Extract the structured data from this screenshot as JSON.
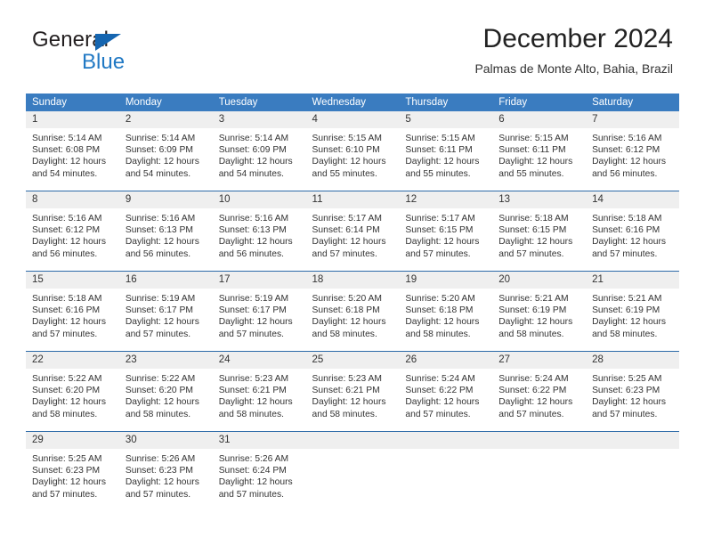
{
  "brand": {
    "name_part1": "General",
    "name_part2": "Blue",
    "triangle_color": "#1565b0",
    "blue_color": "#2179c4"
  },
  "header": {
    "title": "December 2024",
    "location": "Palmas de Monte Alto, Bahia, Brazil"
  },
  "theme": {
    "header_row_background": "#3a7cc0",
    "header_row_text": "#ffffff",
    "daynum_background": "#efefef",
    "row_divider": "#2c6aa8",
    "body_text": "#333333"
  },
  "weekday_headers": [
    "Sunday",
    "Monday",
    "Tuesday",
    "Wednesday",
    "Thursday",
    "Friday",
    "Saturday"
  ],
  "labels": {
    "sunrise_prefix": "Sunrise:",
    "sunset_prefix": "Sunset:",
    "daylight_prefix": "Daylight:"
  },
  "weeks": [
    [
      {
        "day": "1",
        "sunrise": "Sunrise: 5:14 AM",
        "sunset": "Sunset: 6:08 PM",
        "daylight_line1": "Daylight: 12 hours",
        "daylight_line2": "and 54 minutes."
      },
      {
        "day": "2",
        "sunrise": "Sunrise: 5:14 AM",
        "sunset": "Sunset: 6:09 PM",
        "daylight_line1": "Daylight: 12 hours",
        "daylight_line2": "and 54 minutes."
      },
      {
        "day": "3",
        "sunrise": "Sunrise: 5:14 AM",
        "sunset": "Sunset: 6:09 PM",
        "daylight_line1": "Daylight: 12 hours",
        "daylight_line2": "and 54 minutes."
      },
      {
        "day": "4",
        "sunrise": "Sunrise: 5:15 AM",
        "sunset": "Sunset: 6:10 PM",
        "daylight_line1": "Daylight: 12 hours",
        "daylight_line2": "and 55 minutes."
      },
      {
        "day": "5",
        "sunrise": "Sunrise: 5:15 AM",
        "sunset": "Sunset: 6:11 PM",
        "daylight_line1": "Daylight: 12 hours",
        "daylight_line2": "and 55 minutes."
      },
      {
        "day": "6",
        "sunrise": "Sunrise: 5:15 AM",
        "sunset": "Sunset: 6:11 PM",
        "daylight_line1": "Daylight: 12 hours",
        "daylight_line2": "and 55 minutes."
      },
      {
        "day": "7",
        "sunrise": "Sunrise: 5:16 AM",
        "sunset": "Sunset: 6:12 PM",
        "daylight_line1": "Daylight: 12 hours",
        "daylight_line2": "and 56 minutes."
      }
    ],
    [
      {
        "day": "8",
        "sunrise": "Sunrise: 5:16 AM",
        "sunset": "Sunset: 6:12 PM",
        "daylight_line1": "Daylight: 12 hours",
        "daylight_line2": "and 56 minutes."
      },
      {
        "day": "9",
        "sunrise": "Sunrise: 5:16 AM",
        "sunset": "Sunset: 6:13 PM",
        "daylight_line1": "Daylight: 12 hours",
        "daylight_line2": "and 56 minutes."
      },
      {
        "day": "10",
        "sunrise": "Sunrise: 5:16 AM",
        "sunset": "Sunset: 6:13 PM",
        "daylight_line1": "Daylight: 12 hours",
        "daylight_line2": "and 56 minutes."
      },
      {
        "day": "11",
        "sunrise": "Sunrise: 5:17 AM",
        "sunset": "Sunset: 6:14 PM",
        "daylight_line1": "Daylight: 12 hours",
        "daylight_line2": "and 57 minutes."
      },
      {
        "day": "12",
        "sunrise": "Sunrise: 5:17 AM",
        "sunset": "Sunset: 6:15 PM",
        "daylight_line1": "Daylight: 12 hours",
        "daylight_line2": "and 57 minutes."
      },
      {
        "day": "13",
        "sunrise": "Sunrise: 5:18 AM",
        "sunset": "Sunset: 6:15 PM",
        "daylight_line1": "Daylight: 12 hours",
        "daylight_line2": "and 57 minutes."
      },
      {
        "day": "14",
        "sunrise": "Sunrise: 5:18 AM",
        "sunset": "Sunset: 6:16 PM",
        "daylight_line1": "Daylight: 12 hours",
        "daylight_line2": "and 57 minutes."
      }
    ],
    [
      {
        "day": "15",
        "sunrise": "Sunrise: 5:18 AM",
        "sunset": "Sunset: 6:16 PM",
        "daylight_line1": "Daylight: 12 hours",
        "daylight_line2": "and 57 minutes."
      },
      {
        "day": "16",
        "sunrise": "Sunrise: 5:19 AM",
        "sunset": "Sunset: 6:17 PM",
        "daylight_line1": "Daylight: 12 hours",
        "daylight_line2": "and 57 minutes."
      },
      {
        "day": "17",
        "sunrise": "Sunrise: 5:19 AM",
        "sunset": "Sunset: 6:17 PM",
        "daylight_line1": "Daylight: 12 hours",
        "daylight_line2": "and 57 minutes."
      },
      {
        "day": "18",
        "sunrise": "Sunrise: 5:20 AM",
        "sunset": "Sunset: 6:18 PM",
        "daylight_line1": "Daylight: 12 hours",
        "daylight_line2": "and 58 minutes."
      },
      {
        "day": "19",
        "sunrise": "Sunrise: 5:20 AM",
        "sunset": "Sunset: 6:18 PM",
        "daylight_line1": "Daylight: 12 hours",
        "daylight_line2": "and 58 minutes."
      },
      {
        "day": "20",
        "sunrise": "Sunrise: 5:21 AM",
        "sunset": "Sunset: 6:19 PM",
        "daylight_line1": "Daylight: 12 hours",
        "daylight_line2": "and 58 minutes."
      },
      {
        "day": "21",
        "sunrise": "Sunrise: 5:21 AM",
        "sunset": "Sunset: 6:19 PM",
        "daylight_line1": "Daylight: 12 hours",
        "daylight_line2": "and 58 minutes."
      }
    ],
    [
      {
        "day": "22",
        "sunrise": "Sunrise: 5:22 AM",
        "sunset": "Sunset: 6:20 PM",
        "daylight_line1": "Daylight: 12 hours",
        "daylight_line2": "and 58 minutes."
      },
      {
        "day": "23",
        "sunrise": "Sunrise: 5:22 AM",
        "sunset": "Sunset: 6:20 PM",
        "daylight_line1": "Daylight: 12 hours",
        "daylight_line2": "and 58 minutes."
      },
      {
        "day": "24",
        "sunrise": "Sunrise: 5:23 AM",
        "sunset": "Sunset: 6:21 PM",
        "daylight_line1": "Daylight: 12 hours",
        "daylight_line2": "and 58 minutes."
      },
      {
        "day": "25",
        "sunrise": "Sunrise: 5:23 AM",
        "sunset": "Sunset: 6:21 PM",
        "daylight_line1": "Daylight: 12 hours",
        "daylight_line2": "and 58 minutes."
      },
      {
        "day": "26",
        "sunrise": "Sunrise: 5:24 AM",
        "sunset": "Sunset: 6:22 PM",
        "daylight_line1": "Daylight: 12 hours",
        "daylight_line2": "and 57 minutes."
      },
      {
        "day": "27",
        "sunrise": "Sunrise: 5:24 AM",
        "sunset": "Sunset: 6:22 PM",
        "daylight_line1": "Daylight: 12 hours",
        "daylight_line2": "and 57 minutes."
      },
      {
        "day": "28",
        "sunrise": "Sunrise: 5:25 AM",
        "sunset": "Sunset: 6:23 PM",
        "daylight_line1": "Daylight: 12 hours",
        "daylight_line2": "and 57 minutes."
      }
    ],
    [
      {
        "day": "29",
        "sunrise": "Sunrise: 5:25 AM",
        "sunset": "Sunset: 6:23 PM",
        "daylight_line1": "Daylight: 12 hours",
        "daylight_line2": "and 57 minutes."
      },
      {
        "day": "30",
        "sunrise": "Sunrise: 5:26 AM",
        "sunset": "Sunset: 6:23 PM",
        "daylight_line1": "Daylight: 12 hours",
        "daylight_line2": "and 57 minutes."
      },
      {
        "day": "31",
        "sunrise": "Sunrise: 5:26 AM",
        "sunset": "Sunset: 6:24 PM",
        "daylight_line1": "Daylight: 12 hours",
        "daylight_line2": "and 57 minutes."
      },
      {
        "day": "",
        "sunrise": "",
        "sunset": "",
        "daylight_line1": "",
        "daylight_line2": ""
      },
      {
        "day": "",
        "sunrise": "",
        "sunset": "",
        "daylight_line1": "",
        "daylight_line2": ""
      },
      {
        "day": "",
        "sunrise": "",
        "sunset": "",
        "daylight_line1": "",
        "daylight_line2": ""
      },
      {
        "day": "",
        "sunrise": "",
        "sunset": "",
        "daylight_line1": "",
        "daylight_line2": ""
      }
    ]
  ]
}
